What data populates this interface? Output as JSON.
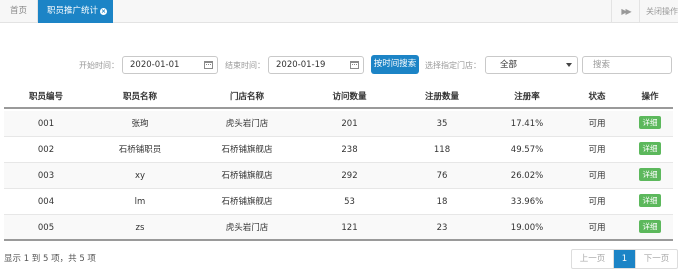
{
  "tabs": {
    "home": "首页",
    "active": "职员推广统计",
    "close_ops": "关闭操作"
  },
  "filters": {
    "start_label": "开始时间：",
    "start_value": "2020-01-01",
    "end_label": "结束时间：",
    "end_value": "2020-01-19",
    "search_button": "按时间搜索",
    "store_label": "选择指定门店：",
    "store_selected": "全部",
    "search_placeholder": "搜索"
  },
  "table": {
    "headers": [
      "职员编号",
      "职员名称",
      "门店名称",
      "访问数量",
      "注册数量",
      "注册率",
      "状态",
      "操作"
    ],
    "rows": [
      {
        "id": "001",
        "name": "张珣",
        "store": "虎头岩门店",
        "visits": "201",
        "regs": "35",
        "rate": "17.41%",
        "status": "可用",
        "action": "详细"
      },
      {
        "id": "002",
        "name": "石桥铺职员",
        "store": "石桥铺旗舰店",
        "visits": "238",
        "regs": "118",
        "rate": "49.57%",
        "status": "可用",
        "action": "详细"
      },
      {
        "id": "003",
        "name": "xy",
        "store": "石桥铺旗舰店",
        "visits": "292",
        "regs": "76",
        "rate": "26.02%",
        "status": "可用",
        "action": "详细"
      },
      {
        "id": "004",
        "name": "lm",
        "store": "石桥铺旗舰店",
        "visits": "53",
        "regs": "18",
        "rate": "33.96%",
        "status": "可用",
        "action": "详细"
      },
      {
        "id": "005",
        "name": "zs",
        "store": "虎头岩门店",
        "visits": "121",
        "regs": "23",
        "rate": "19.00%",
        "status": "可用",
        "action": "详细"
      }
    ]
  },
  "footer": {
    "summary": "显示 1 到 5 项，共 5 项",
    "prev": "上一页",
    "page": "1",
    "next": "下一页"
  },
  "colors": {
    "primary": "#1c84c6",
    "success": "#5cb85c"
  }
}
